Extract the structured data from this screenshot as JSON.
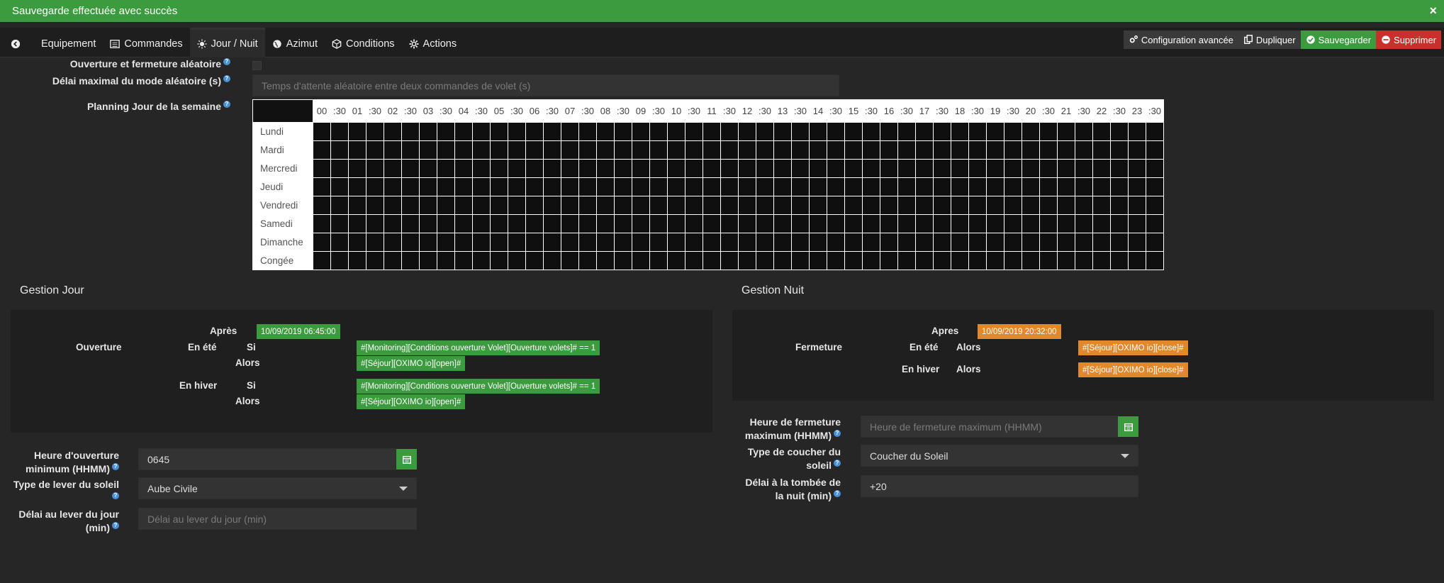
{
  "alert": {
    "message": "Sauvegarde effectuée avec succès",
    "close": "×"
  },
  "tabs": [
    {
      "label": "Equipement",
      "icon": ""
    },
    {
      "label": "Commandes",
      "icon": "list-icon"
    },
    {
      "label": "Jour / Nuit",
      "icon": "sun-icon"
    },
    {
      "label": "Azimut",
      "icon": "globe-icon"
    },
    {
      "label": "Conditions",
      "icon": "cube-icon"
    },
    {
      "label": "Actions",
      "icon": "gear-icon"
    }
  ],
  "actions": {
    "config": "Configuration avancée",
    "duplicate": "Dupliquer",
    "save": "Sauvegarder",
    "delete": "Supprimer"
  },
  "random": {
    "label": "Ouverture et fermeture aléatoire",
    "delay_label": "Délai maximal du mode aléatoire (s)",
    "delay_placeholder": "Temps d'attente aléatoire entre deux commandes de volet (s)"
  },
  "planning": {
    "label": "Planning Jour de la semaine",
    "hours": [
      "00",
      ":30",
      "01",
      ":30",
      "02",
      ":30",
      "03",
      ":30",
      "04",
      ":30",
      "05",
      ":30",
      "06",
      ":30",
      "07",
      ":30",
      "08",
      ":30",
      "09",
      ":30",
      "10",
      ":30",
      "11",
      ":30",
      "12",
      ":30",
      "13",
      ":30",
      "14",
      ":30",
      "15",
      ":30",
      "16",
      ":30",
      "17",
      ":30",
      "18",
      ":30",
      "19",
      ":30",
      "20",
      ":30",
      "21",
      ":30",
      "22",
      ":30",
      "23",
      ":30"
    ],
    "days": [
      "Lundi",
      "Mardi",
      "Mercredi",
      "Jeudi",
      "Vendredi",
      "Samedi",
      "Dimanche",
      "Congée"
    ]
  },
  "jour": {
    "title": "Gestion Jour",
    "apres": "Après",
    "apres_value": "10/09/2019 06:45:00",
    "ouverture": "Ouverture",
    "en_ete": "En été",
    "en_hiver": "En hiver",
    "si": "Si",
    "alors": "Alors",
    "ete_si": "#[Monitoring][Conditions ouverture Volet][Ouverture volets]# == 1",
    "ete_alors": "#[Séjour][OXIMO io][open]#",
    "hiver_si": "#[Monitoring][Conditions ouverture Volet][Ouverture volets]# == 1",
    "hiver_alors": "#[Séjour][OXIMO io][open]#",
    "heure_label_1": "Heure d'ouverture",
    "heure_label_2": "minimum (HHMM)",
    "heure_value": "0645",
    "type_label_1": "Type de lever du soleil",
    "type_value": "Aube Civile",
    "delai_label_1": "Délai au lever du jour",
    "delai_label_2": "(min)",
    "delai_placeholder": "Délai au lever du jour (min)"
  },
  "nuit": {
    "title": "Gestion Nuit",
    "apres": "Apres",
    "apres_value": "10/09/2019 20:32:00",
    "fermeture": "Fermeture",
    "en_ete": "En été",
    "en_hiver": "En hiver",
    "alors": "Alors",
    "ete_alors": "#[Séjour][OXIMO io][close]#",
    "hiver_alors": "#[Séjour][OXIMO io][close]#",
    "heure_label_1": "Heure de fermeture",
    "heure_label_2": "maximum (HHMM)",
    "heure_placeholder": "Heure de fermeture maximum (HHMM)",
    "type_label_1": "Type de coucher du",
    "type_label_2": "soleil",
    "type_value": "Coucher du Soleil",
    "delai_label_1": "Délai à la tombée de",
    "delai_label_2": "la nuit (min)",
    "delai_value": "+20"
  },
  "colors": {
    "success": "#3c9a3f",
    "danger": "#c9302c",
    "warning": "#e0882a",
    "background": "#262626"
  }
}
